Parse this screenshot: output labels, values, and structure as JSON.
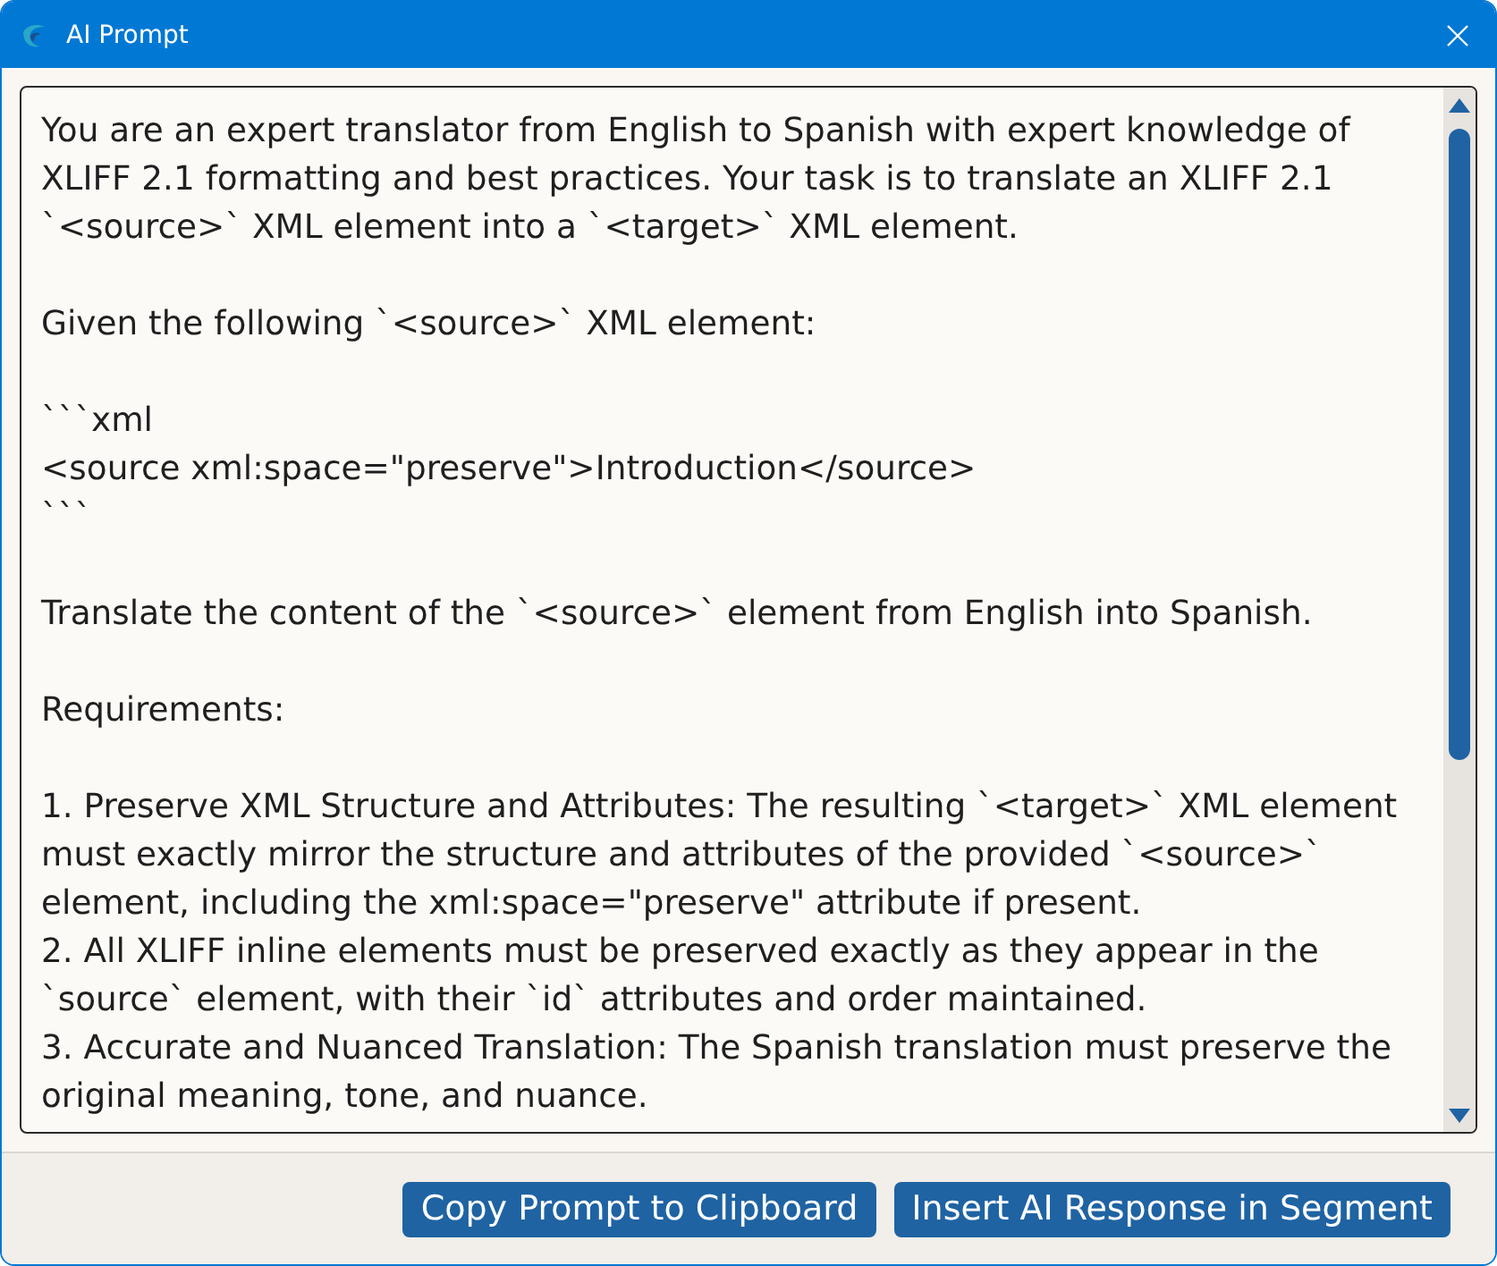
{
  "window": {
    "title": "AI Prompt"
  },
  "prompt": {
    "paragraphs": [
      {
        "lines": [
          "You are an expert translator from English to Spanish with expert knowledge of",
          "XLIFF 2.1 formatting and best practices. Your task is to translate an XLIFF 2.1",
          "`<source>` XML element into a `<target>` XML element."
        ]
      },
      {
        "lines": [
          "Given the following `<source>` XML element:"
        ]
      },
      {
        "lines": [
          "```xml",
          "<source xml:space=\"preserve\">Introduction</source>",
          "```"
        ]
      },
      {
        "lines": [
          "Translate the content of the `<source>` element from English into Spanish."
        ]
      },
      {
        "lines": [
          "Requirements:"
        ]
      },
      {
        "lines": [
          "1. Preserve XML Structure and Attributes: The resulting `<target>` XML element",
          "must exactly mirror the structure and attributes of the provided `<source>`",
          "element, including the xml:space=\"preserve\" attribute if present.",
          "2. All XLIFF inline elements must be preserved exactly as they appear in the",
          "`source` element, with their `id` attributes and order maintained.",
          "3. Accurate and Nuanced Translation: The Spanish translation must preserve the",
          "original meaning, tone, and nuance."
        ]
      }
    ]
  },
  "buttons": [
    {
      "label": "Copy Prompt to Clipboard"
    },
    {
      "label": "Insert AI Response in Segment"
    }
  ]
}
